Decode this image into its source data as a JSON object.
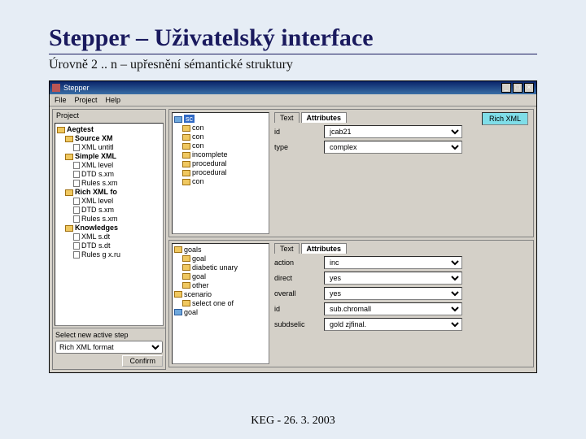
{
  "slide": {
    "title": "Stepper – Uživatelský interface",
    "subtitle": "Úrovně 2 .. n – upřesnění sémantické struktury",
    "footer": "KEG - 26. 3. 2003"
  },
  "window": {
    "title": "Stepper",
    "btn_min": "_",
    "btn_max": "□",
    "btn_close": "×"
  },
  "menu": {
    "file": "File",
    "project": "Project",
    "help": "Help"
  },
  "left": {
    "label": "Project",
    "tree": [
      {
        "ind": 0,
        "t": "fldr",
        "lbl": "Aegtest",
        "bold": true
      },
      {
        "ind": 1,
        "t": "fldr",
        "lbl": "Source XM",
        "bold": true
      },
      {
        "ind": 2,
        "t": "doc",
        "lbl": "XML   untitl"
      },
      {
        "ind": 1,
        "t": "fldr",
        "lbl": "Simple XML",
        "bold": true
      },
      {
        "ind": 2,
        "t": "doc",
        "lbl": "XML   level"
      },
      {
        "ind": 2,
        "t": "doc",
        "lbl": "DTD   s.xm"
      },
      {
        "ind": 2,
        "t": "doc",
        "lbl": "Rules  s.xm"
      },
      {
        "ind": 1,
        "t": "fldr",
        "lbl": "Rich XML fo",
        "bold": true
      },
      {
        "ind": 2,
        "t": "doc",
        "lbl": "XML   level"
      },
      {
        "ind": 2,
        "t": "doc",
        "lbl": "DTD   s.xm"
      },
      {
        "ind": 2,
        "t": "doc",
        "lbl": "Rules  s.xm"
      },
      {
        "ind": 1,
        "t": "fldr",
        "lbl": "Knowledges",
        "bold": true
      },
      {
        "ind": 2,
        "t": "doc",
        "lbl": "XML    s.dt"
      },
      {
        "ind": 2,
        "t": "doc",
        "lbl": "DTD   s.dt"
      },
      {
        "ind": 2,
        "t": "doc",
        "lbl": "Rules  g x.ru"
      }
    ],
    "bottom_label": "Select new active step",
    "select_value": "Rich XML format",
    "confirm": "Confirm"
  },
  "paneTop": {
    "tree": [
      {
        "ind": 0,
        "t": "fb",
        "lbl": "sc",
        "hl": true
      },
      {
        "ind": 1,
        "t": "fldr",
        "lbl": "con"
      },
      {
        "ind": 1,
        "t": "fldr",
        "lbl": "con"
      },
      {
        "ind": 1,
        "t": "fldr",
        "lbl": "con"
      },
      {
        "ind": 1,
        "t": "fldr",
        "lbl": "incomplete"
      },
      {
        "ind": 1,
        "t": "fldr",
        "lbl": "procedural"
      },
      {
        "ind": 1,
        "t": "fldr",
        "lbl": "procedural"
      },
      {
        "ind": 1,
        "t": "fldr",
        "lbl": "con"
      }
    ],
    "tab_text": "Text",
    "tab_attr": "Attributes",
    "rows": [
      {
        "lbl": "id",
        "val": "jcab21"
      },
      {
        "lbl": "type",
        "val": "complex"
      }
    ],
    "richxml": "Rich XML"
  },
  "paneBottom": {
    "tree": [
      {
        "ind": 0,
        "t": "fldr",
        "lbl": "goals"
      },
      {
        "ind": 1,
        "t": "fldr",
        "lbl": "goal"
      },
      {
        "ind": 1,
        "t": "fldr",
        "lbl": "diabetic unary"
      },
      {
        "ind": 1,
        "t": "fldr",
        "lbl": "goal"
      },
      {
        "ind": 1,
        "t": "fldr",
        "lbl": "other"
      },
      {
        "ind": 0,
        "t": "fldr",
        "lbl": "scenario"
      },
      {
        "ind": 1,
        "t": "fldr",
        "lbl": "select one of"
      },
      {
        "ind": 0,
        "t": "fb",
        "lbl": "goal"
      }
    ],
    "tab_text": "Text",
    "tab_attr": "Attributes",
    "rows": [
      {
        "lbl": "action",
        "val": "inc"
      },
      {
        "lbl": "direct",
        "val": "yes"
      },
      {
        "lbl": "overall",
        "val": "yes"
      },
      {
        "lbl": "id",
        "val": "sub.chromall"
      },
      {
        "lbl": "subdselic",
        "val": "gold zjfinal."
      }
    ]
  }
}
